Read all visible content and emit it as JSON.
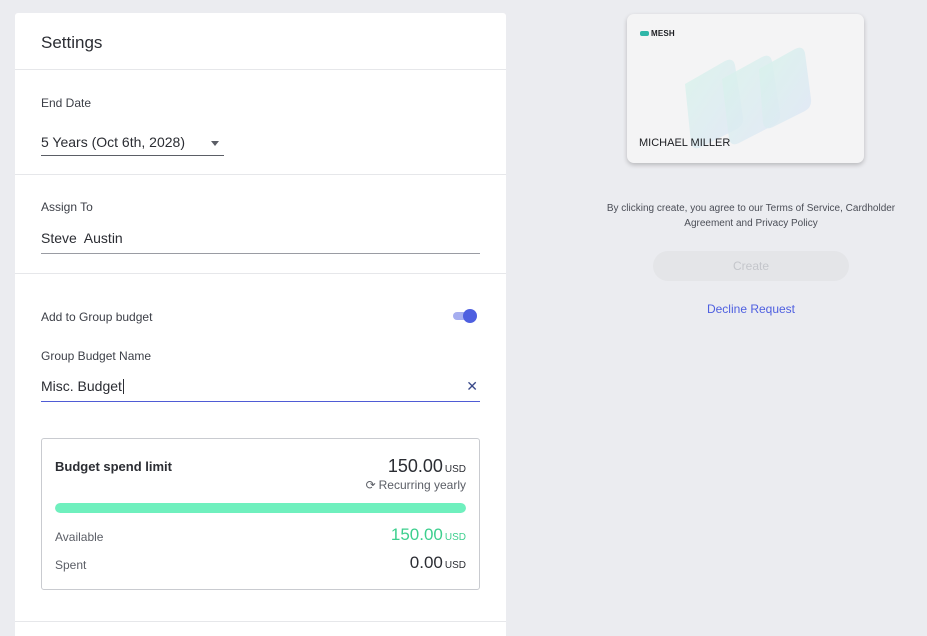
{
  "settings": {
    "title": "Settings",
    "end_date": {
      "label": "End Date",
      "value": "5 Years (Oct 6th, 2028)"
    },
    "assign_to": {
      "label": "Assign To",
      "value": "Steve  Austin"
    },
    "group_budget": {
      "toggle_label": "Add to Group budget",
      "toggle_on": true,
      "name_label": "Group Budget Name",
      "name_value": "Misc. Budget",
      "clear_icon": "close-icon"
    },
    "budget_box": {
      "title": "Budget spend limit",
      "limit": "150.00",
      "limit_unit": "USD",
      "recurring": "Recurring yearly",
      "recurring_icon": "refresh-icon",
      "available_fraction": 1.0,
      "available_label": "Available",
      "available_value": "150.00",
      "available_unit": "USD",
      "spent_label": "Spent",
      "spent_value": "0.00",
      "spent_unit": "USD"
    }
  },
  "card": {
    "brand": "MESH",
    "holder": "MICHAEL MILLER"
  },
  "terms_text": "By clicking create, you agree to our Terms of Service, Cardholder Agreement and Privacy Policy",
  "create_label": "Create",
  "decline_label": "Decline Request",
  "colors": {
    "accent": "#4e5fe0",
    "progress": "#6ff0be",
    "available_green": "#3dcf8e",
    "background": "#ebecf0"
  }
}
